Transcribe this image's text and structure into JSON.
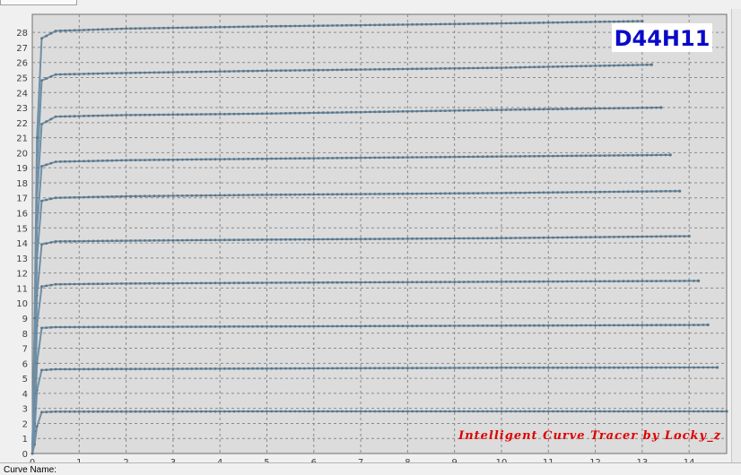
{
  "status": {
    "curve_name_label": "Curve Name:"
  },
  "chart_data": {
    "type": "line",
    "title": "D44H11",
    "watermark": "Intelligent Curve Tracer by Locky_z",
    "xlabel": "",
    "ylabel": "",
    "xlim": [
      0,
      14.8
    ],
    "ylim": [
      0,
      29.2
    ],
    "x_ticks": [
      0,
      1,
      2,
      3,
      4,
      5,
      6,
      7,
      8,
      9,
      10,
      11,
      12,
      13,
      14
    ],
    "y_ticks": [
      0,
      1,
      2,
      3,
      4,
      5,
      6,
      7,
      8,
      9,
      10,
      11,
      12,
      13,
      14,
      15,
      16,
      17,
      18,
      19,
      20,
      21,
      22,
      23,
      24,
      25,
      26,
      27,
      28
    ],
    "grid": true,
    "legend": "none",
    "colors": {
      "series": "#6f8fa6",
      "marker": "#5b7587",
      "plot_bg": "#dcdcdc",
      "grid": "#8a8a8a",
      "title": "#0a0ac8",
      "watermark": "#e00000"
    },
    "series": [
      {
        "points": [
          [
            0,
            0
          ],
          [
            0.05,
            0.6
          ],
          [
            0.1,
            1.8
          ],
          [
            0.2,
            2.75
          ],
          [
            0.5,
            2.78
          ],
          [
            2,
            2.79
          ],
          [
            5,
            2.8
          ],
          [
            10,
            2.8
          ],
          [
            14.8,
            2.8
          ]
        ]
      },
      {
        "points": [
          [
            0,
            0
          ],
          [
            0.05,
            1.5
          ],
          [
            0.1,
            4.2
          ],
          [
            0.2,
            5.55
          ],
          [
            0.5,
            5.6
          ],
          [
            2,
            5.62
          ],
          [
            5,
            5.65
          ],
          [
            10,
            5.7
          ],
          [
            14.6,
            5.72
          ]
        ]
      },
      {
        "points": [
          [
            0,
            0
          ],
          [
            0.05,
            2
          ],
          [
            0.1,
            6
          ],
          [
            0.2,
            8.35
          ],
          [
            0.5,
            8.4
          ],
          [
            2,
            8.42
          ],
          [
            5,
            8.45
          ],
          [
            10,
            8.5
          ],
          [
            14.4,
            8.55
          ]
        ]
      },
      {
        "points": [
          [
            0,
            0
          ],
          [
            0.05,
            3
          ],
          [
            0.1,
            8.5
          ],
          [
            0.2,
            11.1
          ],
          [
            0.5,
            11.25
          ],
          [
            2,
            11.3
          ],
          [
            5,
            11.35
          ],
          [
            10,
            11.42
          ],
          [
            14.2,
            11.48
          ]
        ]
      },
      {
        "points": [
          [
            0,
            0
          ],
          [
            0.05,
            4
          ],
          [
            0.1,
            10.5
          ],
          [
            0.2,
            13.9
          ],
          [
            0.5,
            14.1
          ],
          [
            2,
            14.15
          ],
          [
            5,
            14.22
          ],
          [
            10,
            14.32
          ],
          [
            14,
            14.45
          ]
        ]
      },
      {
        "points": [
          [
            0,
            0
          ],
          [
            0.05,
            5
          ],
          [
            0.1,
            13
          ],
          [
            0.2,
            16.8
          ],
          [
            0.5,
            17
          ],
          [
            2,
            17.1
          ],
          [
            5,
            17.2
          ],
          [
            10,
            17.32
          ],
          [
            13.8,
            17.45
          ]
        ]
      },
      {
        "points": [
          [
            0,
            0
          ],
          [
            0.05,
            6
          ],
          [
            0.1,
            15
          ],
          [
            0.2,
            19.1
          ],
          [
            0.5,
            19.4
          ],
          [
            2,
            19.5
          ],
          [
            5,
            19.6
          ],
          [
            10,
            19.75
          ],
          [
            13.6,
            19.85
          ]
        ]
      },
      {
        "points": [
          [
            0,
            0
          ],
          [
            0.05,
            7
          ],
          [
            0.1,
            17
          ],
          [
            0.2,
            21.9
          ],
          [
            0.5,
            22.4
          ],
          [
            2,
            22.5
          ],
          [
            5,
            22.6
          ],
          [
            10,
            22.85
          ],
          [
            13.4,
            23.0
          ]
        ]
      },
      {
        "points": [
          [
            0,
            0
          ],
          [
            0.05,
            8
          ],
          [
            0.1,
            19
          ],
          [
            0.2,
            24.8
          ],
          [
            0.5,
            25.2
          ],
          [
            2,
            25.3
          ],
          [
            5,
            25.45
          ],
          [
            10,
            25.65
          ],
          [
            13.2,
            25.85
          ]
        ]
      },
      {
        "points": [
          [
            0,
            0
          ],
          [
            0.05,
            9
          ],
          [
            0.1,
            21
          ],
          [
            0.2,
            27.6
          ],
          [
            0.5,
            28.1
          ],
          [
            2,
            28.25
          ],
          [
            5,
            28.4
          ],
          [
            10,
            28.6
          ],
          [
            13,
            28.75
          ]
        ]
      }
    ]
  }
}
